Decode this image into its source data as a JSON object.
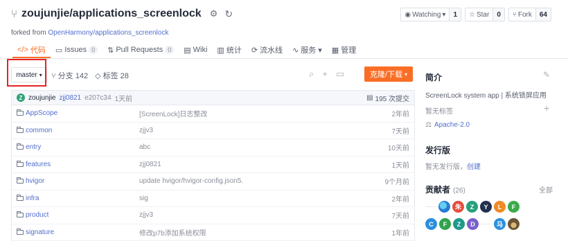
{
  "header": {
    "repo_title": "zoujunjie/applications_screenlock",
    "watching_label": "Watching",
    "watching_count": "1",
    "star_label": "Star",
    "star_count": "0",
    "fork_label": "Fork",
    "fork_count": "64",
    "forked_from_prefix": "forked from",
    "forked_from_link": "OpenHarmony/applications_screenlock"
  },
  "tabs": [
    {
      "label": "代码",
      "badge": ""
    },
    {
      "label": "Issues",
      "badge": "0"
    },
    {
      "label": "Pull Requests",
      "badge": "0"
    },
    {
      "label": "Wiki",
      "badge": ""
    },
    {
      "label": "统计",
      "badge": ""
    },
    {
      "label": "流水线",
      "badge": ""
    },
    {
      "label": "服务",
      "badge": ""
    },
    {
      "label": "管理",
      "badge": ""
    }
  ],
  "toolbar": {
    "branch": "master",
    "branches_label": "分支 142",
    "tags_label": "标签 28",
    "clone_label": "克隆/下载"
  },
  "commit": {
    "avatar_letter": "Z",
    "user": "zoujunjie",
    "message": "zjj0821",
    "hash": "e207c34",
    "time": "1天前",
    "count_label": "195 次提交"
  },
  "files": [
    {
      "name": "AppScope",
      "message": "[ScreenLock]日志整改",
      "time": "2年前"
    },
    {
      "name": "common",
      "message": "zjjv3",
      "time": "7天前"
    },
    {
      "name": "entry",
      "message": "abc",
      "time": "10天前"
    },
    {
      "name": "features",
      "message": "zjj0821",
      "time": "1天前"
    },
    {
      "name": "hvigor",
      "message": "update hvigor/hvigor-config.json5.",
      "time": "9个月前"
    },
    {
      "name": "infra",
      "message": "sig",
      "time": "2年前"
    },
    {
      "name": "product",
      "message": "zjjv3",
      "time": "7天前"
    },
    {
      "name": "signature",
      "message": "修改p7b添加系统权限",
      "time": "1年前"
    }
  ],
  "sidebar": {
    "intro_title": "简介",
    "description": "ScreenLock system app | 系统锁屏应用",
    "no_tags": "暂无标签",
    "license": "Apache-2.0",
    "releases_title": "发行版",
    "no_releases": "暂无发行版，",
    "create_link": "创建",
    "contributors_title": "贡献者",
    "contributors_count": "(26)",
    "all_link": "全部"
  },
  "contributors_row1": [
    {
      "letter": "",
      "color": "#ffffff",
      "kind": "small"
    },
    {
      "letter": "",
      "color": "#2a7ad8",
      "kind": "edge"
    },
    {
      "letter": "朱",
      "color": "#e64c3c"
    },
    {
      "letter": "Z",
      "color": "#27a17b"
    },
    {
      "letter": "Y",
      "color": "#23314f"
    },
    {
      "letter": "L",
      "color": "#f08a24"
    },
    {
      "letter": "F",
      "color": "#3aaa4a"
    }
  ],
  "contributors_row2": [
    {
      "letter": "C",
      "color": "#2b8fe0"
    },
    {
      "letter": "F",
      "color": "#2ea34b"
    },
    {
      "letter": "Z",
      "color": "#1f9a8a"
    },
    {
      "letter": "D",
      "color": "#7b61c9"
    },
    {
      "letter": "",
      "color": "#ffffff",
      "kind": "small"
    },
    {
      "letter": "马",
      "color": "#2b8fe0"
    },
    {
      "letter": "",
      "color": "#8a7a5a",
      "kind": "photo"
    }
  ],
  "colors": {
    "accent": "#fa6d25",
    "link": "#526ecc",
    "highlight_box": "#e52222"
  }
}
